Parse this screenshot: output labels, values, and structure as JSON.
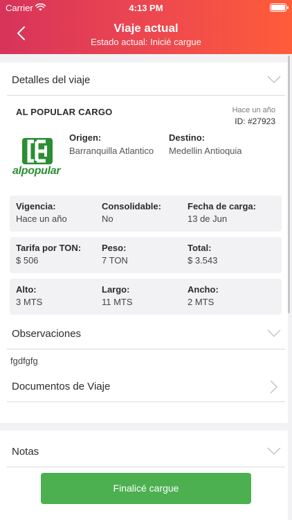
{
  "status_bar": {
    "carrier": "Carrier",
    "time": "4:13 PM"
  },
  "header": {
    "title": "Viaje actual",
    "subtitle": "Estado actual: Inicié cargue"
  },
  "details": {
    "section_label": "Detalles del viaje",
    "company": "AL POPULAR CARGO",
    "posted": "Hace un año",
    "trip_id": "ID: #27923",
    "logo_text": "alpopular",
    "origin_label": "Origen:",
    "origin_value": "Barranquilla Atlantico",
    "destination_label": "Destino:",
    "destination_value": "Medellin Antioquia",
    "rows": [
      [
        {
          "label": "Vigencia:",
          "value": "Hace un año"
        },
        {
          "label": "Consolidable:",
          "value": "No"
        },
        {
          "label": "Fecha de carga:",
          "value": "13 de Jun"
        }
      ],
      [
        {
          "label": "Tarifa por TON:",
          "value": "$ 506"
        },
        {
          "label": "Peso:",
          "value": "7 TON"
        },
        {
          "label": "Total:",
          "value": "$ 3.543"
        }
      ],
      [
        {
          "label": "Alto:",
          "value": "3 MTS"
        },
        {
          "label": "Largo:",
          "value": "11 MTS"
        },
        {
          "label": "Ancho:",
          "value": "2 MTS"
        }
      ]
    ]
  },
  "observations": {
    "label": "Observaciones",
    "text": "fgdfgfg"
  },
  "documents": {
    "label": "Documentos de Viaje"
  },
  "notes": {
    "label": "Notas"
  },
  "action": {
    "label": "Finalicé cargue"
  },
  "colors": {
    "header_start": "#d7335b",
    "header_end": "#ff5c3a",
    "button": "#4cb050",
    "logo_green": "#2a8e33"
  }
}
